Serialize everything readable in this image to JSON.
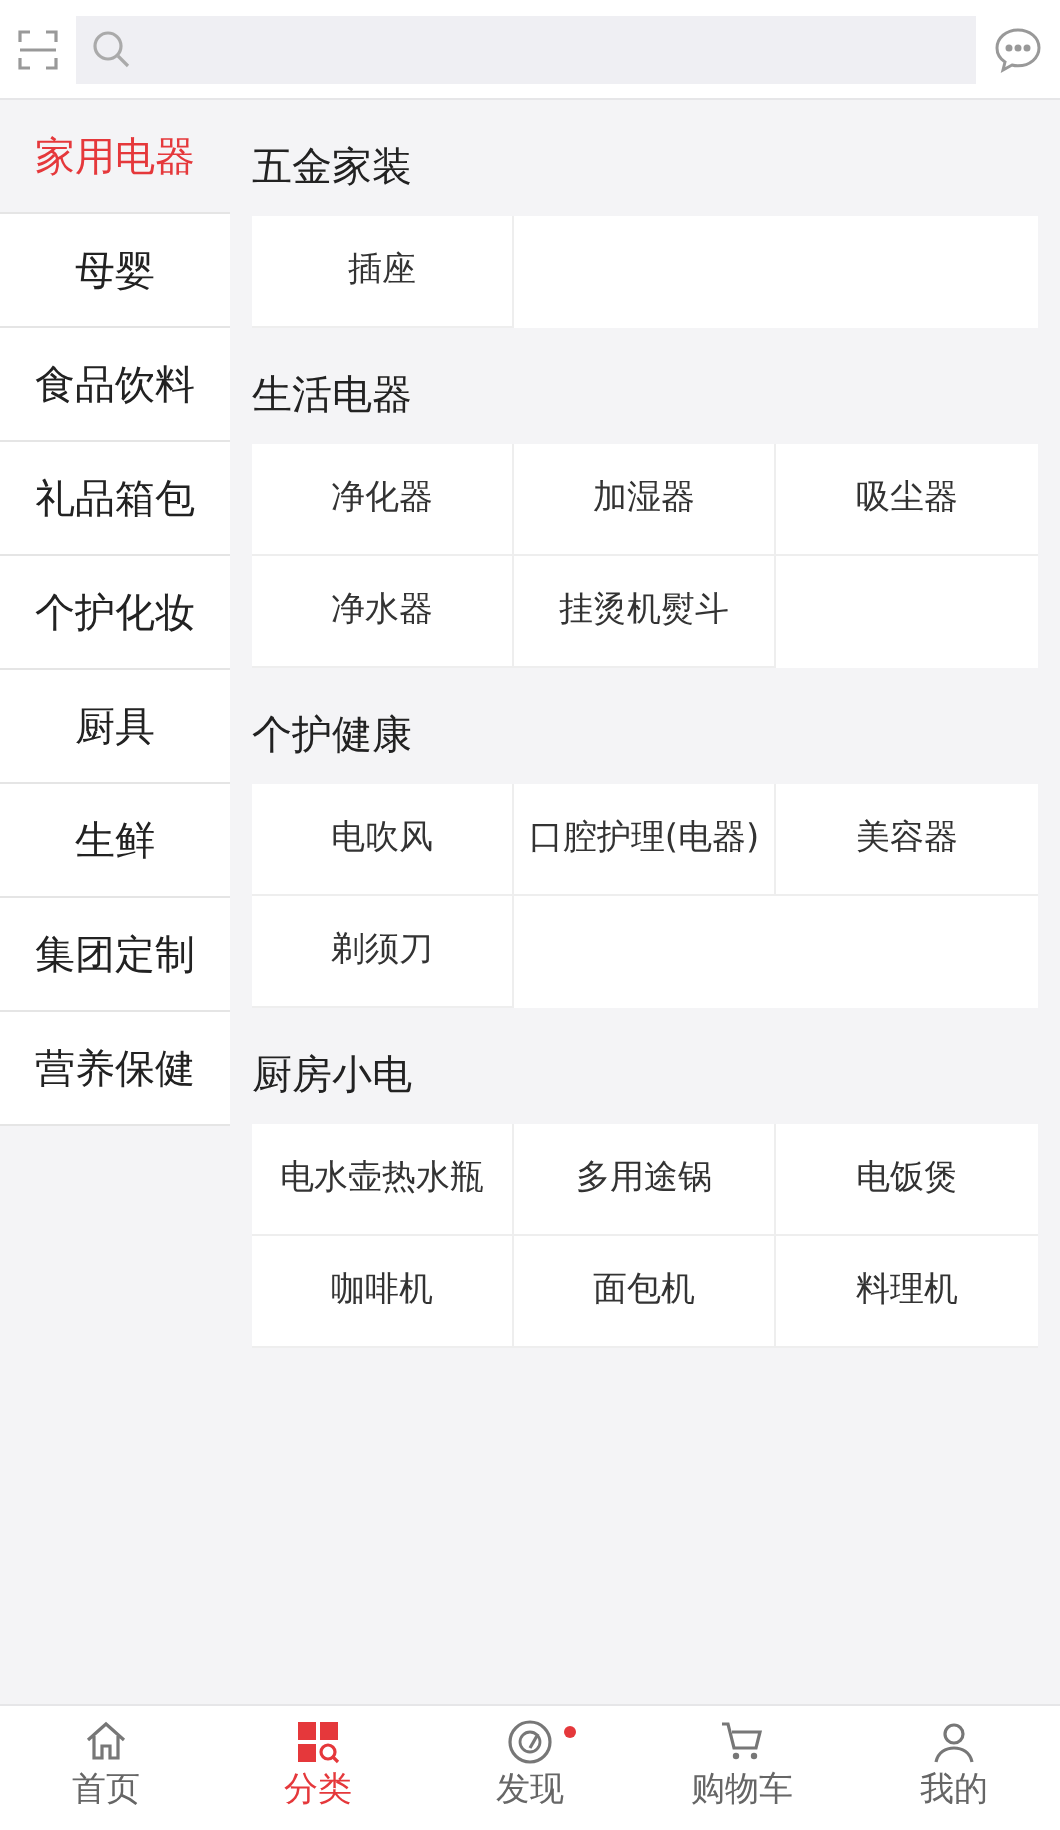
{
  "sidebar": {
    "items": [
      {
        "label": "家用电器",
        "selected": true
      },
      {
        "label": "母婴",
        "selected": false
      },
      {
        "label": "食品饮料",
        "selected": false
      },
      {
        "label": "礼品箱包",
        "selected": false
      },
      {
        "label": "个护化妆",
        "selected": false
      },
      {
        "label": "厨具",
        "selected": false
      },
      {
        "label": "生鲜",
        "selected": false
      },
      {
        "label": "集团定制",
        "selected": false
      },
      {
        "label": "营养保健",
        "selected": false
      }
    ]
  },
  "sections": [
    {
      "title": "五金家装",
      "items": [
        "插座"
      ]
    },
    {
      "title": "生活电器",
      "items": [
        "净化器",
        "加湿器",
        "吸尘器",
        "净水器",
        "挂烫机熨斗"
      ]
    },
    {
      "title": "个护健康",
      "items": [
        "电吹风",
        "口腔护理(电器)",
        "美容器",
        "剃须刀"
      ]
    },
    {
      "title": "厨房小电",
      "items": [
        "电水壶热水瓶",
        "多用途锅",
        "电饭煲",
        "咖啡机",
        "面包机",
        "料理机"
      ]
    }
  ],
  "tab_bar": [
    {
      "label": "首页",
      "kind": "home",
      "selected": false,
      "dot": false
    },
    {
      "label": "分类",
      "kind": "category",
      "selected": true,
      "dot": false
    },
    {
      "label": "发现",
      "kind": "discover",
      "selected": false,
      "dot": true
    },
    {
      "label": "购物车",
      "kind": "cart",
      "selected": false,
      "dot": false
    },
    {
      "label": "我的",
      "kind": "me",
      "selected": false,
      "dot": false
    }
  ]
}
